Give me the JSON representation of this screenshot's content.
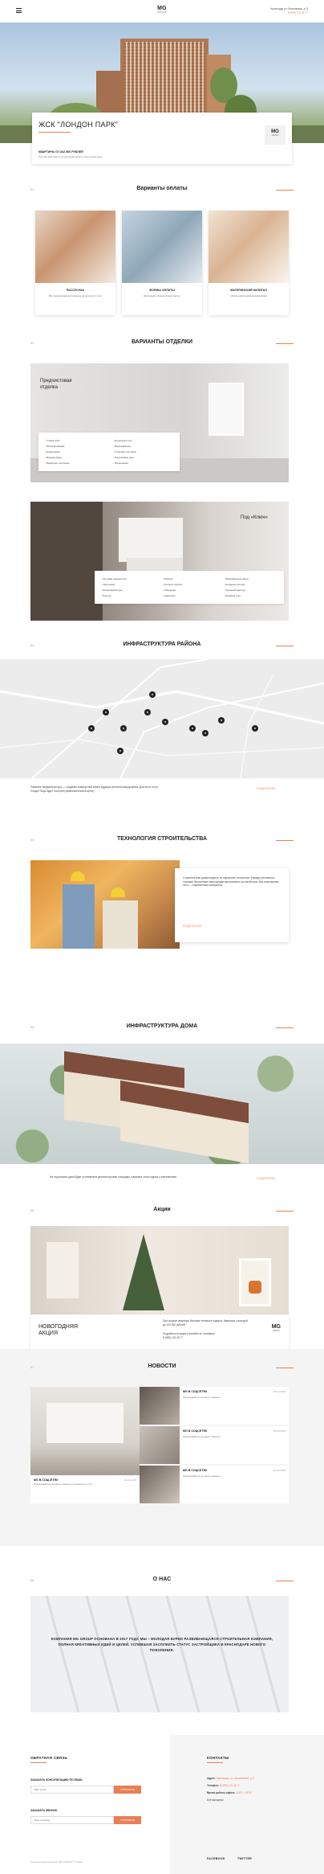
{
  "header": {
    "logo_main": "MG",
    "logo_sub": "GROUP",
    "address": "Краснодар ул. Московская, д. 5",
    "phone": "8 (999) 123 45 77"
  },
  "hero": {
    "title": "ЖСК \"ЛОНДОН ПАРК\"",
    "subtitle": "КВАРТИРЫ ОТ 842 500 РУБЛЕЙ",
    "desc": "Лучшая квартира в городе Краснодар по доступной цене",
    "logo_main": "MG",
    "logo_sub": "GROUP"
  },
  "payment": {
    "num": "01",
    "title": "Варианты оплаты",
    "cards": [
      {
        "title": "РАССРОЧКА",
        "desc": "Без первоначального взноса на срок до 3-х лет"
      },
      {
        "title": "ФОРМЫ ОПЛАТЫ",
        "desc": "Наличный и безналичный расчет"
      },
      {
        "title": "МАТЕРИНСКИЙ КАПИТАЛ",
        "desc": "Оплата материнским капиталом"
      }
    ]
  },
  "finishing": {
    "num": "02",
    "title": "ВАРИАНТЫ ОТДЕЛКИ",
    "pre_label_1": "Предчистовая",
    "pre_label_2": "отделка",
    "pre_items": [
      "Стяжка пола",
      "Штукатурка стен",
      "Электроразводка",
      "Водоснабжение",
      "Канализация",
      "Установка счетчиков",
      "Входная дверь",
      "Пластиковые окна",
      "Радиаторы отопления",
      "Подоконники"
    ],
    "key_label": "Под «Ключ»",
    "key_items": [
      "Чистовая отделка стен",
      "Ламинат",
      "Межкомнатные двери",
      "Сантехника",
      "Плитка в санузле",
      "Натяжные потолки",
      "Электрофурнитура",
      "Освещение",
      "Кухонный гарнитур",
      "Плинтус",
      "Смесители",
      "Покраска стен"
    ]
  },
  "district": {
    "num": "03",
    "title": "ИНФРАСТРУКТУРА РАЙОНА",
    "text": "Развитие инфраструктуры — создание комфортной жизни будущих жителей микрорайона. Для этого на ул. Лондон Парк будет построен развлекательный центр.",
    "more": "ПОДРОБНЕЕ"
  },
  "tech": {
    "num": "04",
    "title": "ТЕХНОЛОГИЯ СТРОИТЕЛЬСТВА",
    "text": "Строительство домов ведется по каркасной технологии. Фасады утепляются плитами. Внутренние перегородки выполняются из газобетона. Все инженерные сети — современные материалы.",
    "more": "ПОДРОБНЕЕ"
  },
  "house": {
    "num": "05",
    "title": "ИНФРАСТРУКТУРА ДОМА",
    "text": "На территории дома будет установлена детская игровая площадка, парковка, зона отдыха с озеленением.",
    "more": "ПОДРОБНЕЕ"
  },
  "promo": {
    "num": "06",
    "title": "Акции",
    "card_title_1": "НОВОГОДНЯЯ",
    "card_title_2": "АКЦИЯ",
    "card_text": "При покупке квартиры бытовая техника в подарок. Квартиры с выгодой до 120 000 рублей!",
    "card_note": "Подробности акции уточняйте по телефону",
    "card_phone": "8 (999) 123 45 77",
    "logo_main": "MG",
    "logo_sub": "GROUP"
  },
  "news": {
    "num": "07",
    "title": "НОВОСТИ",
    "big": {
      "title": "MG В СОЦСЕТЯХ",
      "date": "20.04.2018",
      "text": "Подписывайтесь на наши страницы в социальных сетях"
    },
    "items": [
      {
        "title": "MG В СОЦСЕТЯХ",
        "date": "20.04.2018",
        "text": "Подписывайтесь на наши страницы"
      },
      {
        "title": "MG В СОЦСЕТЯХ",
        "date": "20.04.2018",
        "text": "Подписывайтесь на наши страницы"
      },
      {
        "title": "MG В СОЦСЕТЯХ",
        "date": "20.04.2018",
        "text": "Подписывайтесь на наши страницы"
      }
    ]
  },
  "about": {
    "num": "08",
    "title": "О НАС",
    "text": "КОМПАНИЯ MG GROUP ОСНОВАНА В 2017 ГОДУ. МЫ – МОЛОДАЯ БУРНО РАЗВИВАЮЩАЯСЯ СТРОИТЕЛЬНАЯ КОМПАНИЯ, ПОЛНАЯ КРЕАТИВНЫХ ИДЕЙ И ЦЕЛЕЙ, УСПЕВШАЯ ЗАСЛУЖИТЬ СТАТУС ЗАСТРОЙЩИКА В КРАСНОДАРЕ НОВОГО ПОКОЛЕНИЯ."
  },
  "feedback": {
    "title": "ОБРАТНАЯ СВЯЗЬ",
    "email_label": "ЗАКАЗАТЬ КОНСУЛЬТАЦИЮ ПО EMAIL",
    "email_placeholder": "Ваш email",
    "call_label": "ЗАКАЗАТЬ ЗВОНОК",
    "call_placeholder": "Ваш телефон",
    "button": "ОТПРАВИТЬ",
    "copyright": "Строительная компания \"MG GROUP\" © 2018 г."
  },
  "contacts": {
    "title": "КОНТАКТЫ",
    "address_label": "Адрес:",
    "address": "Краснодар, ул. Московская, д. 5",
    "phone_label": "Телефон:",
    "phone": "8 (999) 123 45 77",
    "hours_label": "Время работы офиса:",
    "hours": "10:00 – 19:00",
    "weekend": "Без выходных",
    "facebook": "FACEBOOK",
    "twitter": "TWITTER"
  }
}
